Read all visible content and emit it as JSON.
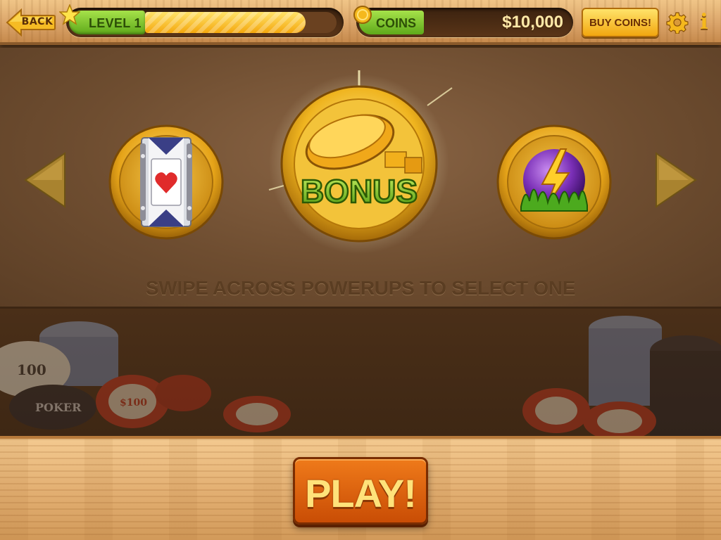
{
  "topbar": {
    "back_label": "BACK",
    "level_label": "LEVEL 1",
    "level_progress": 0.84,
    "coins_label": "COINS",
    "coins_value": "$10,000",
    "buy_label": "BUY COINS!",
    "info_label": "i"
  },
  "powerups": {
    "center_label": "BONUS",
    "hint": "SWIPE ACROSS POWERUPS TO SELECT ONE"
  },
  "play": {
    "label": "PLAY!"
  },
  "chips": {
    "left_chip_1": "100",
    "left_chip_2": "POKER",
    "red_chip": "$100"
  },
  "colors": {
    "accent_green": "#7ec832",
    "gold": "#f5b81d",
    "play_orange": "#e06a10"
  },
  "icons": [
    "back-arrow-icon",
    "star-icon",
    "coin-icon",
    "gear-icon",
    "info-icon",
    "chevron-left-icon",
    "chevron-right-icon",
    "slot-reel-icon",
    "bonus-coin-icon",
    "lightning-orb-icon"
  ]
}
